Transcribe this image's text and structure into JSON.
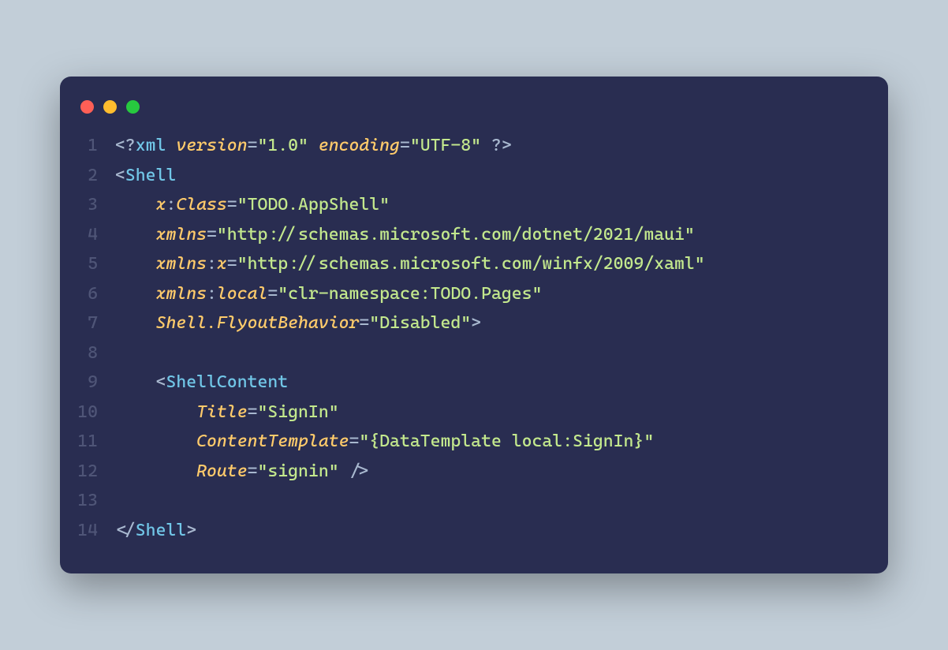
{
  "lineNumbers": [
    "1",
    "2",
    "3",
    "4",
    "5",
    "6",
    "7",
    "8",
    "9",
    "10",
    "11",
    "12",
    "13",
    "14"
  ],
  "code": {
    "l1": {
      "p1": "<?",
      "tag": "xml",
      "sp1": " ",
      "a1": "version",
      "eq1": "=",
      "s1": "\"1.0\"",
      "sp2": " ",
      "a2": "encoding",
      "eq2": "=",
      "s2": "\"UTF-8\"",
      "sp3": " ",
      "p2": "?>"
    },
    "l2": {
      "p1": "<",
      "tag": "Shell"
    },
    "l3": {
      "ind": "    ",
      "a1": "x",
      "colon": ":",
      "a2": "Class",
      "eq": "=",
      "s": "\"TODO.AppShell\""
    },
    "l4": {
      "ind": "    ",
      "a1": "xmlns",
      "eq": "=",
      "s": "\"http://schemas.microsoft.com/dotnet/2021/maui\""
    },
    "l5": {
      "ind": "    ",
      "a1": "xmlns",
      "colon": ":",
      "a2": "x",
      "eq": "=",
      "s": "\"http://schemas.microsoft.com/winfx/2009/xaml\""
    },
    "l6": {
      "ind": "    ",
      "a1": "xmlns",
      "colon": ":",
      "a2": "local",
      "eq": "=",
      "s": "\"clr-namespace:TODO.Pages\""
    },
    "l7": {
      "ind": "    ",
      "a1": "Shell.FlyoutBehavior",
      "eq": "=",
      "s": "\"Disabled\"",
      "p": ">"
    },
    "l9": {
      "ind": "    ",
      "p1": "<",
      "tag": "ShellContent"
    },
    "l10": {
      "ind": "        ",
      "a1": "Title",
      "eq": "=",
      "s": "\"SignIn\""
    },
    "l11": {
      "ind": "        ",
      "a1": "ContentTemplate",
      "eq": "=",
      "s": "\"{DataTemplate local:SignIn}\""
    },
    "l12": {
      "ind": "        ",
      "a1": "Route",
      "eq": "=",
      "s": "\"signin\"",
      "sp": " ",
      "p": "/>"
    },
    "l14": {
      "p1": "</",
      "tag": "Shell",
      "p2": ">"
    }
  }
}
